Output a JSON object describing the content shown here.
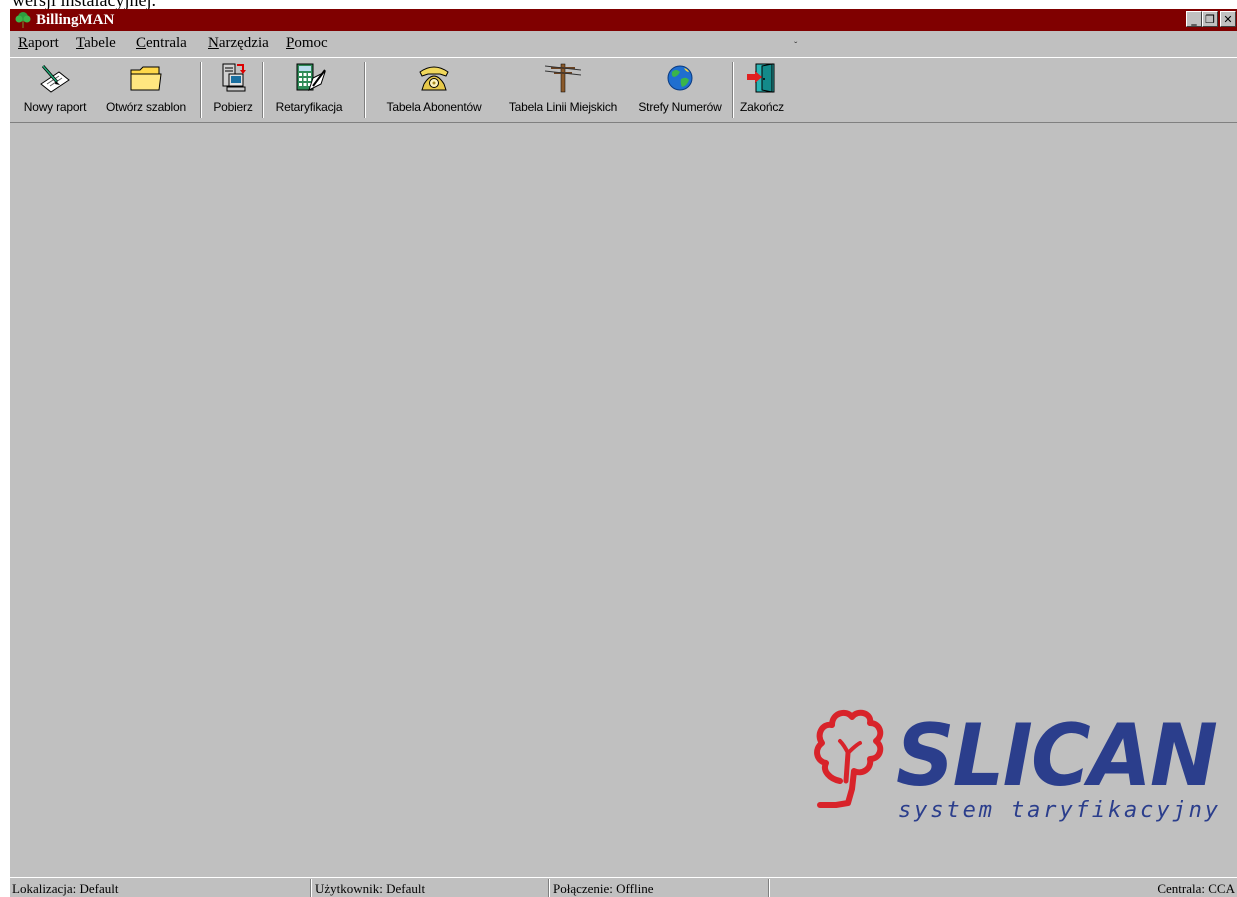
{
  "document_fragment": "wersji instalacyjnej.",
  "window": {
    "title": "BillingMAN",
    "titlebar_color": "#800000",
    "controls": {
      "minimize": "_",
      "restore": "❐",
      "close": "✕"
    }
  },
  "menu": {
    "items": [
      {
        "accel": "R",
        "rest": "aport"
      },
      {
        "accel": "T",
        "rest": "abele"
      },
      {
        "accel": "C",
        "rest": "entrala"
      },
      {
        "accel": "N",
        "rest": "arzędzia"
      },
      {
        "accel": "P",
        "rest": "omoc"
      }
    ]
  },
  "toolbar": {
    "buttons": [
      {
        "label": "Nowy raport",
        "icon": "new-report-icon"
      },
      {
        "label": "Otwórz szablon",
        "icon": "folder-icon"
      },
      {
        "label": "Pobierz",
        "icon": "download-computer-icon"
      },
      {
        "label": "Retaryfikacja",
        "icon": "calculator-icon"
      },
      {
        "label": "Tabela Abonentów",
        "icon": "telephone-icon"
      },
      {
        "label": "Tabela Linii Miejskich",
        "icon": "telephone-pole-icon"
      },
      {
        "label": "Strefy Numerów",
        "icon": "globe-icon"
      },
      {
        "label": "Zakończ",
        "icon": "exit-door-icon"
      }
    ]
  },
  "logo": {
    "brand": "SLICAN",
    "tagline": "system taryfikacyjny",
    "brand_color": "#2b3e8c",
    "tree_color": "#d8232a"
  },
  "statusbar": {
    "location": "Lokalizacja: Default",
    "user": "Użytkownik: Default",
    "connection": "Połączenie: Offline",
    "empty": "",
    "exchange": "Centrala: CCA"
  }
}
